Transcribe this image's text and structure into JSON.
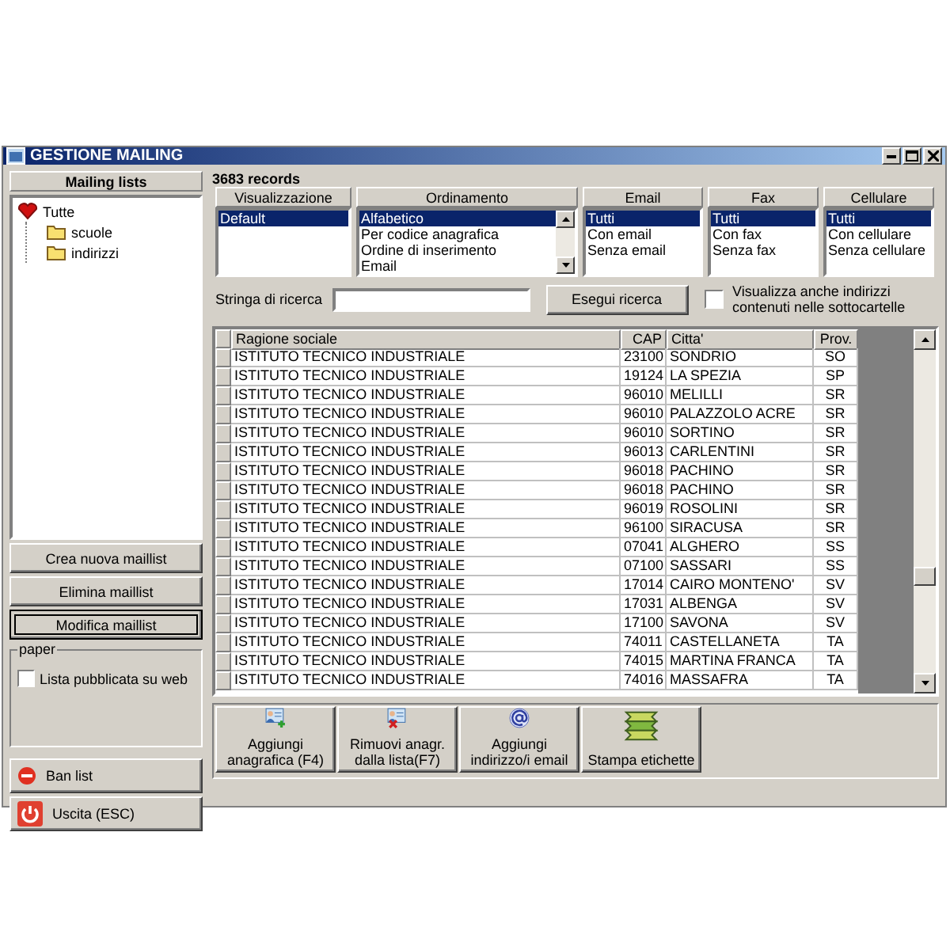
{
  "window": {
    "title": "GESTIONE MAILING"
  },
  "mailing_lists": {
    "title": "Mailing lists",
    "tree": [
      {
        "label": "Tutte",
        "children": [
          {
            "label": "scuole"
          },
          {
            "label": "indirizzi"
          }
        ]
      }
    ],
    "buttons": [
      {
        "label": "Crea nuova maillist",
        "focused": false
      },
      {
        "label": "Elimina maillist",
        "focused": false
      },
      {
        "label": "Modifica maillist",
        "focused": true
      }
    ],
    "paper": {
      "title": "paper",
      "checkbox": {
        "label": "Lista pubblicata su web",
        "checked": false
      }
    },
    "actions": [
      {
        "label": "Ban list",
        "kind": "ban"
      },
      {
        "label": "Uscita (ESC)",
        "kind": "exit"
      }
    ]
  },
  "records": {
    "count": "3683 records",
    "filters": [
      {
        "title": "Visualizzazione",
        "scrollable": false,
        "options": [
          {
            "label": "Default",
            "selected": true
          }
        ]
      },
      {
        "title": "Ordinamento",
        "scrollable": true,
        "options": [
          {
            "label": "Alfabetico",
            "selected": true
          },
          {
            "label": "Per codice anagrafica",
            "selected": false
          },
          {
            "label": "Ordine di inserimento",
            "selected": false
          },
          {
            "label": "Email",
            "selected": false
          }
        ]
      },
      {
        "title": "Email",
        "scrollable": false,
        "options": [
          {
            "label": "Tutti",
            "selected": true
          },
          {
            "label": "Con email",
            "selected": false
          },
          {
            "label": "Senza email",
            "selected": false
          }
        ]
      },
      {
        "title": "Fax",
        "scrollable": false,
        "options": [
          {
            "label": "Tutti",
            "selected": true
          },
          {
            "label": "Con fax",
            "selected": false
          },
          {
            "label": "Senza fax",
            "selected": false
          }
        ]
      },
      {
        "title": "Cellulare",
        "scrollable": false,
        "options": [
          {
            "label": "Tutti",
            "selected": true
          },
          {
            "label": "Con cellulare",
            "selected": false
          },
          {
            "label": "Senza cellulare",
            "selected": false
          }
        ]
      }
    ],
    "search": {
      "label": "Stringa di ricerca",
      "button": "Esegui ricerca",
      "subfolders": {
        "label": "Visualizza anche indirizzi contenuti nelle sottocartelle",
        "checked": false
      }
    },
    "table": {
      "columns": [
        "Ragione sociale",
        "CAP",
        "Citta'",
        "Prov."
      ],
      "rows": [
        [
          "ISTITUTO TECNICO INDUSTRIALE",
          "23100",
          "SONDRIO",
          "SO"
        ],
        [
          "ISTITUTO TECNICO INDUSTRIALE",
          "19124",
          "LA SPEZIA",
          "SP"
        ],
        [
          "ISTITUTO TECNICO INDUSTRIALE",
          "96010",
          "MELILLI",
          "SR"
        ],
        [
          "ISTITUTO TECNICO INDUSTRIALE",
          "96010",
          "PALAZZOLO ACRE",
          "SR"
        ],
        [
          "ISTITUTO TECNICO INDUSTRIALE",
          "96010",
          "SORTINO",
          "SR"
        ],
        [
          "ISTITUTO TECNICO INDUSTRIALE",
          "96013",
          "CARLENTINI",
          "SR"
        ],
        [
          "ISTITUTO TECNICO INDUSTRIALE",
          "96018",
          "PACHINO",
          "SR"
        ],
        [
          "ISTITUTO TECNICO INDUSTRIALE",
          "96018",
          "PACHINO",
          "SR"
        ],
        [
          "ISTITUTO TECNICO INDUSTRIALE",
          "96019",
          "ROSOLINI",
          "SR"
        ],
        [
          "ISTITUTO TECNICO INDUSTRIALE",
          "96100",
          "SIRACUSA",
          "SR"
        ],
        [
          "ISTITUTO TECNICO INDUSTRIALE",
          "07041",
          "ALGHERO",
          "SS"
        ],
        [
          "ISTITUTO TECNICO INDUSTRIALE",
          "07100",
          "SASSARI",
          "SS"
        ],
        [
          "ISTITUTO TECNICO INDUSTRIALE",
          "17014",
          "CAIRO MONTENO'",
          "SV"
        ],
        [
          "ISTITUTO TECNICO INDUSTRIALE",
          "17031",
          "ALBENGA",
          "SV"
        ],
        [
          "ISTITUTO TECNICO INDUSTRIALE",
          "17100",
          "SAVONA",
          "SV"
        ],
        [
          "ISTITUTO TECNICO INDUSTRIALE",
          "74011",
          "CASTELLANETA",
          "TA"
        ],
        [
          "ISTITUTO TECNICO INDUSTRIALE",
          "74015",
          "MARTINA FRANCA",
          "TA"
        ],
        [
          "ISTITUTO TECNICO INDUSTRIALE",
          "74016",
          "MASSAFRA",
          "TA"
        ]
      ]
    },
    "toolbar": [
      {
        "label": "Aggiungi anagrafica (F4)",
        "kind": "add-person"
      },
      {
        "label": "Rimuovi anagr. dalla lista(F7)",
        "kind": "remove-person"
      },
      {
        "label": "Aggiungi indirizzo/i email",
        "kind": "email"
      },
      {
        "label": "Stampa etichette",
        "kind": "labels"
      }
    ]
  }
}
